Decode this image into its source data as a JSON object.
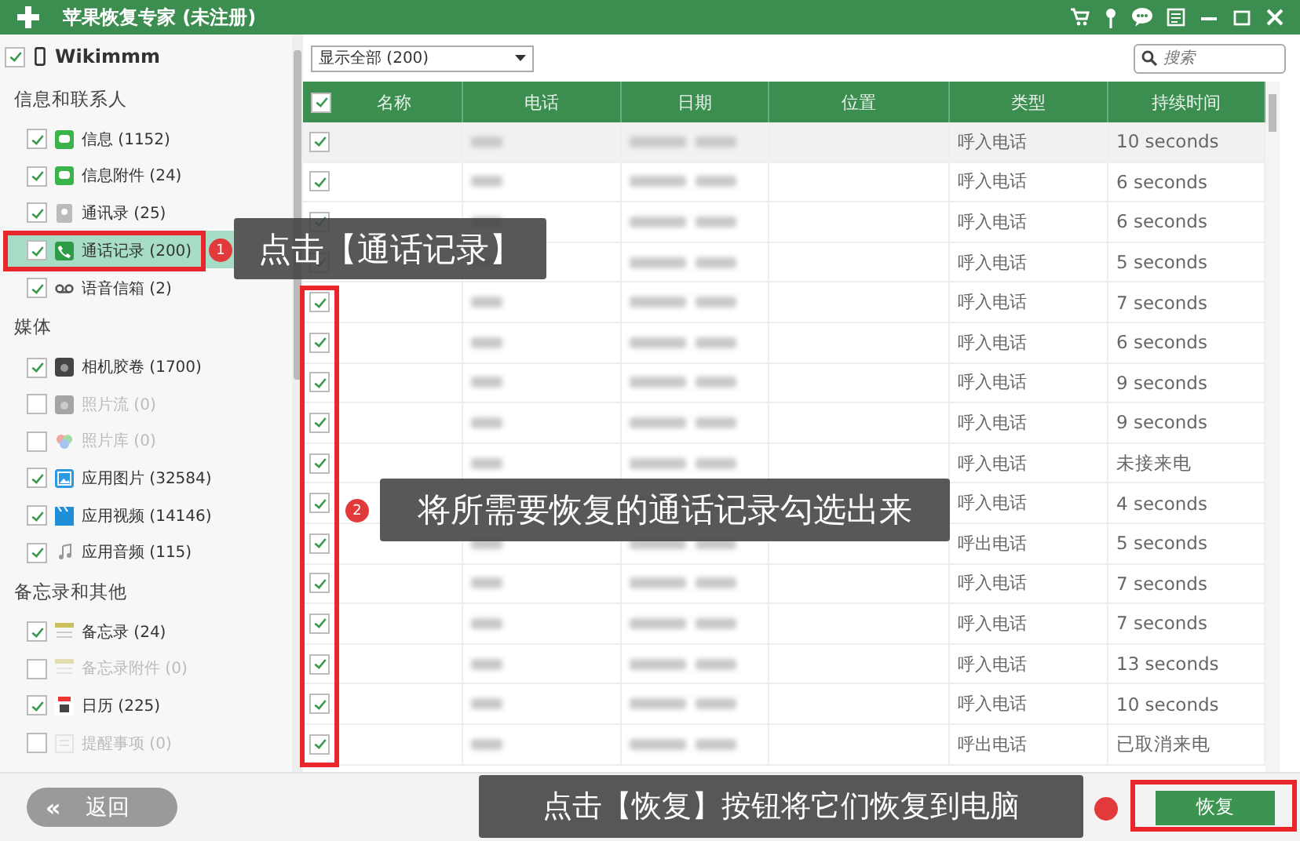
{
  "window": {
    "title": "苹果恢复专家 (未注册)"
  },
  "sidebar": {
    "device": {
      "name": "Wikimmm",
      "checked": true
    },
    "groups": [
      {
        "title": "信息和联系人",
        "items": [
          {
            "label": "信息 (1152)",
            "kind": "message",
            "checked": true,
            "selected": false
          },
          {
            "label": "信息附件 (24)",
            "kind": "message",
            "checked": true,
            "selected": false
          },
          {
            "label": "通讯录 (25)",
            "kind": "contacts",
            "checked": true,
            "selected": false
          },
          {
            "label": "通话记录 (200)",
            "kind": "call",
            "checked": true,
            "selected": true
          },
          {
            "label": "语音信箱 (2)",
            "kind": "voicemail",
            "checked": true,
            "selected": false
          }
        ]
      },
      {
        "title": "媒体",
        "items": [
          {
            "label": "相机胶卷 (1700)",
            "kind": "camera",
            "checked": true,
            "selected": false
          },
          {
            "label": "照片流 (0)",
            "kind": "camera",
            "checked": false,
            "selected": false
          },
          {
            "label": "照片库 (0)",
            "kind": "photos",
            "checked": false,
            "selected": false
          },
          {
            "label": "应用图片 (32584)",
            "kind": "image",
            "checked": true,
            "selected": false
          },
          {
            "label": "应用视频 (14146)",
            "kind": "video",
            "checked": true,
            "selected": false
          },
          {
            "label": "应用音频 (115)",
            "kind": "audio",
            "checked": true,
            "selected": false
          }
        ]
      },
      {
        "title": "备忘录和其他",
        "items": [
          {
            "label": "备忘录 (24)",
            "kind": "notes",
            "checked": true,
            "selected": false
          },
          {
            "label": "备忘录附件 (0)",
            "kind": "notes",
            "checked": false,
            "selected": false
          },
          {
            "label": "日历 (225)",
            "kind": "calendar",
            "checked": true,
            "selected": false
          },
          {
            "label": "提醒事项 (0)",
            "kind": "reminder",
            "checked": false,
            "selected": false
          }
        ]
      }
    ]
  },
  "filter": {
    "value": "显示全部 (200)"
  },
  "search": {
    "placeholder": "搜索"
  },
  "table": {
    "all_checked": true,
    "columns": [
      "名称",
      "电话",
      "日期",
      "位置",
      "类型",
      "持续时间"
    ],
    "rows": [
      {
        "checked": true,
        "selected": true,
        "type": "呼入电话",
        "duration": "10 seconds"
      },
      {
        "checked": true,
        "selected": false,
        "type": "呼入电话",
        "duration": "6 seconds"
      },
      {
        "checked": true,
        "selected": false,
        "type": "呼入电话",
        "duration": "6 seconds"
      },
      {
        "checked": true,
        "selected": false,
        "type": "呼入电话",
        "duration": "5 seconds"
      },
      {
        "checked": true,
        "selected": false,
        "type": "呼入电话",
        "duration": "7 seconds"
      },
      {
        "checked": true,
        "selected": false,
        "type": "呼入电话",
        "duration": "6 seconds"
      },
      {
        "checked": true,
        "selected": false,
        "type": "呼入电话",
        "duration": "9 seconds"
      },
      {
        "checked": true,
        "selected": false,
        "type": "呼入电话",
        "duration": "9 seconds"
      },
      {
        "checked": true,
        "selected": false,
        "type": "呼入电话",
        "duration": "未接来电"
      },
      {
        "checked": true,
        "selected": false,
        "type": "呼入电话",
        "duration": "4 seconds"
      },
      {
        "checked": true,
        "selected": false,
        "type": "呼出电话",
        "duration": "5 seconds"
      },
      {
        "checked": true,
        "selected": false,
        "type": "呼入电话",
        "duration": "7 seconds"
      },
      {
        "checked": true,
        "selected": false,
        "type": "呼入电话",
        "duration": "7 seconds"
      },
      {
        "checked": true,
        "selected": false,
        "type": "呼入电话",
        "duration": "13 seconds"
      },
      {
        "checked": true,
        "selected": false,
        "type": "呼入电话",
        "duration": "10 seconds"
      },
      {
        "checked": true,
        "selected": false,
        "type": "呼出电话",
        "duration": "已取消来电"
      }
    ]
  },
  "footer": {
    "back_button": {
      "icon": "«",
      "label": "返回"
    },
    "recover_button": "恢复"
  },
  "annotations": [
    {
      "number": "1",
      "text": "点击【通话记录】"
    },
    {
      "number": "2",
      "text": "将所需要恢复的通话记录勾选出来"
    },
    {
      "text": "点击【恢复】按钮将它们恢复到电脑"
    }
  ]
}
